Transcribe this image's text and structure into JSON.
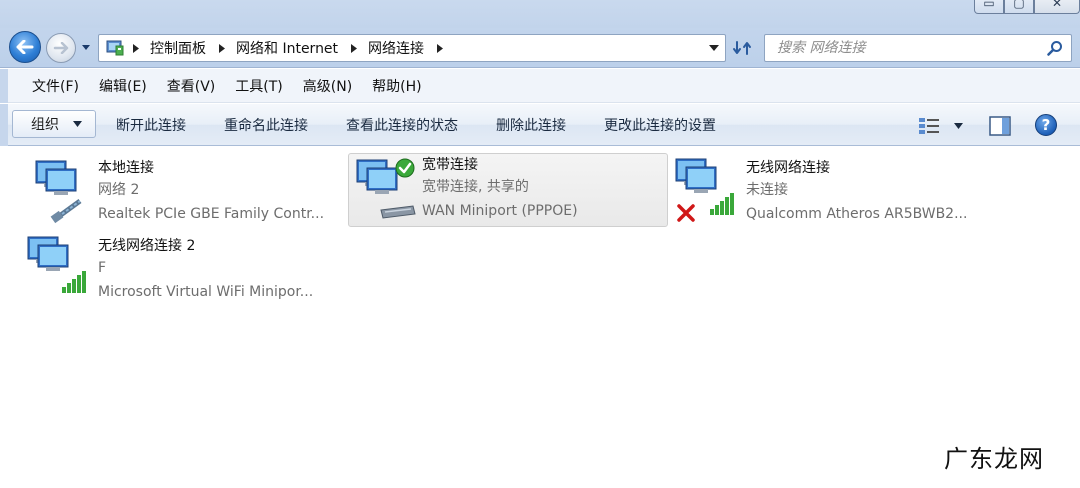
{
  "window": {
    "caption_buttons": {
      "minimize": "▭",
      "maximize": "▢",
      "close": "✕"
    }
  },
  "navigation": {
    "breadcrumbs": [
      "控制面板",
      "网络和 Internet",
      "网络连接"
    ],
    "search_placeholder": "搜索 网络连接"
  },
  "menu": {
    "items": [
      "文件(F)",
      "编辑(E)",
      "查看(V)",
      "工具(T)",
      "高级(N)",
      "帮助(H)"
    ]
  },
  "command_bar": {
    "organize_label": "组织",
    "commands": [
      "断开此连接",
      "重命名此连接",
      "查看此连接的状态",
      "删除此连接",
      "更改此连接的设置"
    ],
    "help_label": "?"
  },
  "connections": [
    {
      "name": "本地连接",
      "status": "网络  2",
      "device": "Realtek PCIe GBE Family Contr...",
      "icon": "wired-adapter-icon",
      "selected": false
    },
    {
      "name": "宽带连接",
      "status": "宽带连接, 共享的",
      "device": "WAN Miniport (PPPOE)",
      "icon": "broadband-modem-icon",
      "selected": true,
      "badge": "connected-check-icon"
    },
    {
      "name": "无线网络连接",
      "status": "未连接",
      "device": "Qualcomm Atheros AR5BWB2...",
      "icon": "wireless-signal-icon",
      "selected": false,
      "badge": "disconnected-x-icon"
    },
    {
      "name": "无线网络连接 2",
      "status": "F",
      "device": "Microsoft Virtual WiFi Minipor...",
      "icon": "wireless-signal-icon",
      "selected": false
    }
  ],
  "watermark": "广东龙网",
  "colors": {
    "accent": "#2f7fd6",
    "chrome": "#c3d5ec",
    "signal_green": "#3aa83a",
    "error_red": "#d01818"
  }
}
